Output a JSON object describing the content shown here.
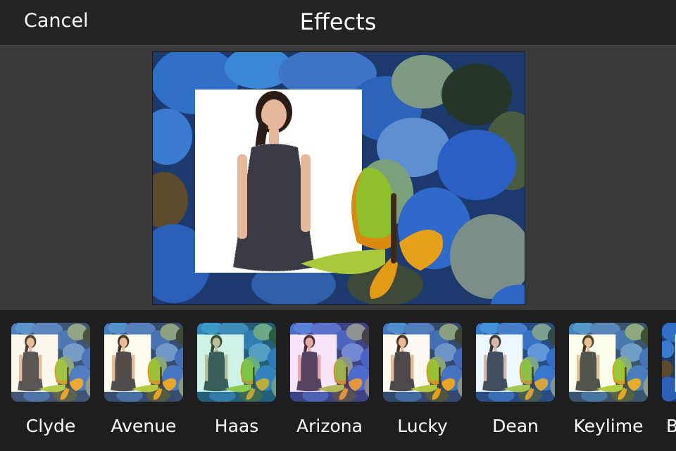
{
  "header": {
    "cancel_label": "Cancel",
    "title": "Effects"
  },
  "colors": {
    "bar": "#232323",
    "background": "#3a3a3a",
    "strip": "#1e1e1e",
    "text": "#ffffff"
  },
  "effects": [
    {
      "label": "Clyde"
    },
    {
      "label": "Avenue"
    },
    {
      "label": "Haas"
    },
    {
      "label": "Arizona"
    },
    {
      "label": "Lucky"
    },
    {
      "label": "Dean"
    },
    {
      "label": "Keylime"
    },
    {
      "label": "B"
    }
  ]
}
